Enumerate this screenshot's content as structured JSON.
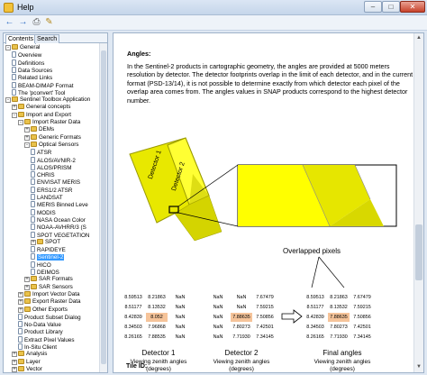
{
  "window": {
    "title": "Help"
  },
  "toolbar": {
    "buttons": [
      "back-icon",
      "forward-icon",
      "print-icon",
      "options-icon"
    ]
  },
  "tabs": [
    {
      "label": "Contents"
    },
    {
      "label": "Search"
    }
  ],
  "tree": {
    "items": [
      {
        "label": "General",
        "type": "folder",
        "expander": "-"
      },
      {
        "label": "Overview",
        "type": "page"
      },
      {
        "label": "Definitions",
        "type": "page"
      },
      {
        "label": "Data Sources",
        "type": "page"
      },
      {
        "label": "Related Links",
        "type": "page"
      },
      {
        "label": "BEAM-DIMAP Format",
        "type": "page"
      },
      {
        "label": "The 'pconvert' Tool",
        "type": "page"
      },
      {
        "label": "Sentinel Toolbox Application",
        "type": "folder",
        "expander": "-"
      },
      {
        "label": "General concepts",
        "type": "folder",
        "expander": "+"
      },
      {
        "label": "Import and Export",
        "type": "folder",
        "expander": "-"
      },
      {
        "label": "Import Raster Data",
        "type": "folder",
        "expander": "-"
      },
      {
        "label": "DEMs",
        "type": "folder",
        "expander": "+"
      },
      {
        "label": "Generic Formats",
        "type": "folder",
        "expander": "+"
      },
      {
        "label": "Optical Sensors",
        "type": "folder",
        "expander": "-"
      },
      {
        "label": "ATSR",
        "type": "page"
      },
      {
        "label": "ALOS/AVNIR-2",
        "type": "page"
      },
      {
        "label": "ALOS/PRISM",
        "type": "page"
      },
      {
        "label": "CHRIS",
        "type": "page"
      },
      {
        "label": "ENVISAT MERIS",
        "type": "page"
      },
      {
        "label": "ERS1/2 ATSR",
        "type": "page"
      },
      {
        "label": "LANDSAT",
        "type": "page"
      },
      {
        "label": "MERIS Binned Leve",
        "type": "page"
      },
      {
        "label": "MODIS",
        "type": "page"
      },
      {
        "label": "NASA Ocean Color",
        "type": "page"
      },
      {
        "label": "NOAA-AVHRR/3 (S",
        "type": "page"
      },
      {
        "label": "SPOT VEGETATION",
        "type": "page"
      },
      {
        "label": "SPOT",
        "type": "folder",
        "expander": "+"
      },
      {
        "label": "RAPIDEYE",
        "type": "page"
      },
      {
        "label": "Sentinel-2",
        "type": "page",
        "selected": true
      },
      {
        "label": "HICO",
        "type": "page"
      },
      {
        "label": "DEIMOS",
        "type": "page"
      },
      {
        "label": "SAR Formats",
        "type": "folder",
        "expander": "+"
      },
      {
        "label": "SAR Sensors",
        "type": "folder",
        "expander": "+"
      },
      {
        "label": "Import Vector Data",
        "type": "folder",
        "expander": "+"
      },
      {
        "label": "Export Raster Data",
        "type": "folder",
        "expander": "+"
      },
      {
        "label": "Other Exports",
        "type": "folder",
        "expander": "+"
      },
      {
        "label": "Product Subset Dialog",
        "type": "page"
      },
      {
        "label": "No-Data Value",
        "type": "page"
      },
      {
        "label": "Product Library",
        "type": "page"
      },
      {
        "label": "Extract Pixel Values",
        "type": "page"
      },
      {
        "label": "In-Situ Client",
        "type": "page"
      },
      {
        "label": "Analysis",
        "type": "folder",
        "expander": "+"
      },
      {
        "label": "Layer",
        "type": "folder",
        "expander": "+"
      },
      {
        "label": "Vector",
        "type": "folder",
        "expander": "+"
      }
    ]
  },
  "content": {
    "section_title": "Angles:",
    "paragraph": "In the Sentinel-2 products in cartographic geometry, the angles are provided at 5000 meters resolution by detector. The detector footprints overlap in the limit of each detector, and in the current format (PSD-13/14), it is not possible to determine exactly from which detector each pixel of the overlap area comes from. The angles values in SNAP products correspond to the highest detector number.",
    "figure": {
      "detector1_band_label": "Detector 1",
      "detector2_band_label": "Detector 2",
      "overlap_label": "Overlapped pixels",
      "grid_left": [
        [
          "8.59513",
          "8.21863",
          "NaN"
        ],
        [
          "8.51177",
          "8.13532",
          "NaN"
        ],
        [
          "8.42839",
          "8.052",
          "NaN"
        ],
        [
          "8.34503",
          "7.96868",
          "NaN"
        ],
        [
          "8.26165",
          "7.88535",
          "NaN"
        ]
      ],
      "grid_middle": [
        [
          "NaN",
          "NaN",
          "7.67479"
        ],
        [
          "NaN",
          "NaN",
          "7.59215"
        ],
        [
          "NaN",
          "7.88635",
          "7.50856"
        ],
        [
          "NaN",
          "7.80273",
          "7.42501"
        ],
        [
          "NaN",
          "7.71930",
          "7.34145"
        ]
      ],
      "grid_right": [
        [
          "8.59513",
          "8.21863",
          "7.67479"
        ],
        [
          "8.51177",
          "8.13532",
          "7.59215"
        ],
        [
          "8.42839",
          "7.88635",
          "7.50856"
        ],
        [
          "8.34503",
          "7.80273",
          "7.42501"
        ],
        [
          "8.26165",
          "7.71930",
          "7.34145"
        ]
      ],
      "caption_left_title": "Detector 1",
      "caption_left_sub1": "Viewing zenith angles",
      "caption_left_sub2": "(degrees)",
      "caption_mid_title": "Detector 2",
      "caption_mid_sub1": "Viewing zenith angles",
      "caption_mid_sub2": "(degrees)",
      "caption_right_title": "Final angles",
      "caption_right_sub1": "Viewing zenith angles",
      "caption_right_sub2": "(degrees)"
    },
    "next_heading": "Tile ID:"
  },
  "colors": {
    "selection": "#3399ff",
    "detector_fill": "#ffff00",
    "detector_shade": "#c8c800",
    "highlight_cell": "#f6c49a"
  }
}
